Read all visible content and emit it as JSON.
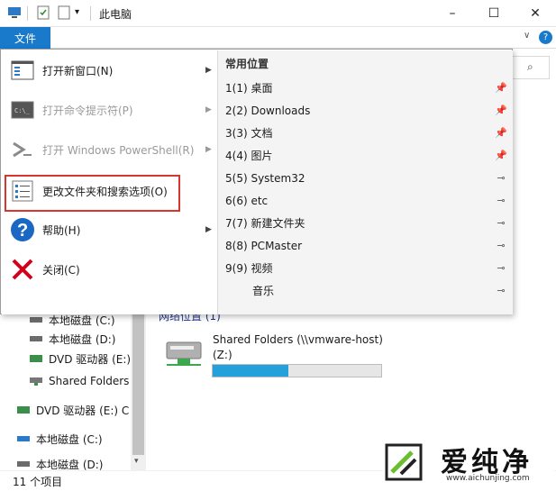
{
  "window": {
    "title": "此电脑",
    "controls": {
      "minimize": "–",
      "maximize": "☐",
      "close": "✕"
    }
  },
  "ribbon": {
    "file_tab": "文件"
  },
  "file_menu": {
    "items": [
      {
        "label": "打开新窗口(N)",
        "has_arrow": true,
        "disabled": false,
        "icon": "new-window-icon"
      },
      {
        "label": "打开命令提示符(P)",
        "has_arrow": true,
        "disabled": true,
        "icon": "command-prompt-icon"
      },
      {
        "label": "打开 Windows PowerShell(R)",
        "has_arrow": true,
        "disabled": true,
        "icon": "powershell-icon"
      },
      {
        "label": "更改文件夹和搜索选项(O)",
        "has_arrow": false,
        "disabled": false,
        "icon": "folder-options-icon"
      },
      {
        "label": "帮助(H)",
        "has_arrow": true,
        "disabled": false,
        "icon": "help-icon"
      },
      {
        "label": "关闭(C)",
        "has_arrow": false,
        "disabled": false,
        "icon": "close-icon"
      }
    ],
    "highlight_color": "#d8352f"
  },
  "frequent_places": {
    "header": "常用位置",
    "items": [
      {
        "label": "1(1)  桌面",
        "pinned": true
      },
      {
        "label": "2(2)  Downloads",
        "pinned": true
      },
      {
        "label": "3(3)  文档",
        "pinned": true
      },
      {
        "label": "4(4)  图片",
        "pinned": true
      },
      {
        "label": "5(5)  System32",
        "pinned": false
      },
      {
        "label": "6(6)  etc",
        "pinned": false
      },
      {
        "label": "7(7)  新建文件夹",
        "pinned": false
      },
      {
        "label": "8(8)  PCMaster",
        "pinned": false
      },
      {
        "label": "9(9)  视频",
        "pinned": false
      },
      {
        "label": "音乐",
        "pinned": false
      }
    ]
  },
  "nav_tree": {
    "items": [
      {
        "label": "本地磁盘 (C:)",
        "icon": "drive-icon"
      },
      {
        "label": "本地磁盘 (D:)",
        "icon": "drive-icon"
      },
      {
        "label": "DVD 驱动器 (E:)",
        "icon": "dvd-drive-icon"
      },
      {
        "label": "Shared Folders",
        "icon": "network-drive-icon"
      },
      {
        "label": "DVD 驱动器 (E:) C",
        "icon": "dvd-drive-icon"
      },
      {
        "label": "本地磁盘 (C:)",
        "icon": "drive-icon"
      },
      {
        "label": "本地磁盘 (D:)",
        "icon": "drive-icon"
      }
    ]
  },
  "content": {
    "group_header": "网络位置 (1)",
    "shared_drive": {
      "name": "Shared Folders (\\\\vmware-host)",
      "letter": "(Z:)",
      "used_fraction": 0.45
    }
  },
  "status": {
    "count": "11 个项目"
  },
  "watermark": {
    "brand": "爱纯净",
    "url": "www.aichunjing.com"
  },
  "colors": {
    "accent": "#1979ca",
    "progress": "#26a0da",
    "help_blue": "#1a67c4",
    "close_red": "#d0021b"
  }
}
